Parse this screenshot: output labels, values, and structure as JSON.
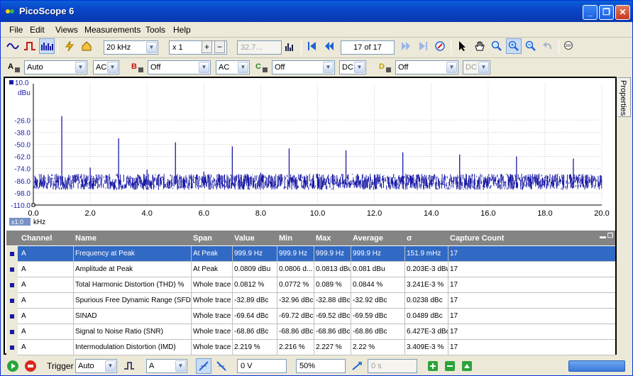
{
  "window": {
    "title": "PicoScope 6"
  },
  "menu": [
    "File",
    "Edit",
    "Views",
    "Measurements",
    "Tools",
    "Help"
  ],
  "toolbar": {
    "timebase": "20 kHz",
    "multiplier": "x 1",
    "sample_value": "32.7...",
    "buffer": "17 of 17"
  },
  "channels": [
    {
      "letter": "A",
      "range": "Auto",
      "coupling": "AC",
      "color": "#1a1aa6"
    },
    {
      "letter": "B",
      "range": "Off",
      "coupling": "AC",
      "color": "#cc1010"
    },
    {
      "letter": "C",
      "range": "Off",
      "coupling": "DC",
      "color": "#2a8a2a"
    },
    {
      "letter": "D",
      "range": "Off",
      "coupling": "DC",
      "color": "#c8a000"
    }
  ],
  "plot": {
    "unit_top": "10.0",
    "unit_label": "dBu",
    "y_ticks": [
      "-26.0",
      "-38.0",
      "-50.0",
      "-62.0",
      "-74.0",
      "-86.0",
      "-98.0",
      "-110.0"
    ],
    "x_ticks": [
      "0.0",
      "2.0",
      "4.0",
      "6.0",
      "8.0",
      "10.0",
      "12.0",
      "14.0",
      "16.0",
      "18.0",
      "20.0"
    ],
    "x_unit": "kHz",
    "zoom": "x1.0"
  },
  "properties_tab": "Properties",
  "measurements": {
    "headers": [
      "Channel",
      "Name",
      "Span",
      "Value",
      "Min",
      "Max",
      "Average",
      "σ",
      "Capture Count"
    ],
    "rows": [
      [
        "A",
        "Frequency at Peak",
        "At Peak",
        "999.9 Hz",
        "999.9 Hz",
        "999.9 Hz",
        "999.9 Hz",
        "151.9 mHz",
        "17"
      ],
      [
        "A",
        "Amplitude at Peak",
        "At Peak",
        "0.0809 dBu",
        "0.0806 d...",
        "0.0813 dBu",
        "0.081 dBu",
        "0.203E-3 dBu",
        "17"
      ],
      [
        "A",
        "Total Harmonic Distortion (THD) %",
        "Whole trace",
        "0.0812 %",
        "0.0772 %",
        "0.089 %",
        "0.0844 %",
        "3.241E-3 %",
        "17"
      ],
      [
        "A",
        "Spurious Free Dynamic Range (SFDR)",
        "Whole trace",
        "-32.89 dBc",
        "-32.96 dBc",
        "-32.88 dBc",
        "-32.92 dBc",
        "0.0238 dBc",
        "17"
      ],
      [
        "A",
        "SINAD",
        "Whole trace",
        "-69.64 dBc",
        "-69.72 dBc",
        "-69.52 dBc",
        "-69.59 dBc",
        "0.0489 dBc",
        "17"
      ],
      [
        "A",
        "Signal to Noise Ratio (SNR)",
        "Whole trace",
        "-68.86 dBc",
        "-68.86 dBc",
        "-68.86 dBc",
        "-68.86 dBc",
        "6.427E-3 dBc",
        "17"
      ],
      [
        "A",
        "Intermodulation Distortion (IMD)",
        "Whole trace",
        "2.219 %",
        "2.216 %",
        "2.227 %",
        "2.22 %",
        "3.409E-3 %",
        "17"
      ]
    ]
  },
  "statusbar": {
    "trigger_label": "Trigger",
    "trigger_mode": "Auto",
    "trigger_channel": "A",
    "threshold": "0 V",
    "pre_trigger": "50%",
    "delay": "0 s"
  }
}
